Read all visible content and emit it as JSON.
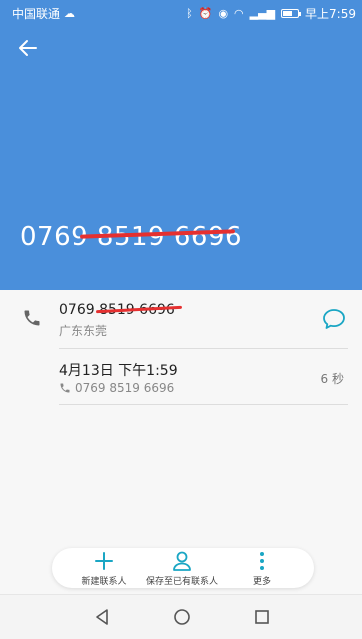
{
  "status_bar": {
    "carrier": "中国联通",
    "time": "早上7:59",
    "signal_text": "4G"
  },
  "header": {
    "phone_number": "0769 8519 6696"
  },
  "detail": {
    "number": "0769 8519 6696",
    "location": "广东东莞",
    "call_date": "4月13日 下午1:59",
    "call_number": "0769 8519 6696",
    "duration": "6 秒"
  },
  "actions": {
    "new_contact": "新建联系人",
    "save_existing": "保存至已有联系人",
    "more": "更多"
  },
  "colors": {
    "header_bg": "#4a8fdb",
    "accent": "#1aa6c4"
  }
}
